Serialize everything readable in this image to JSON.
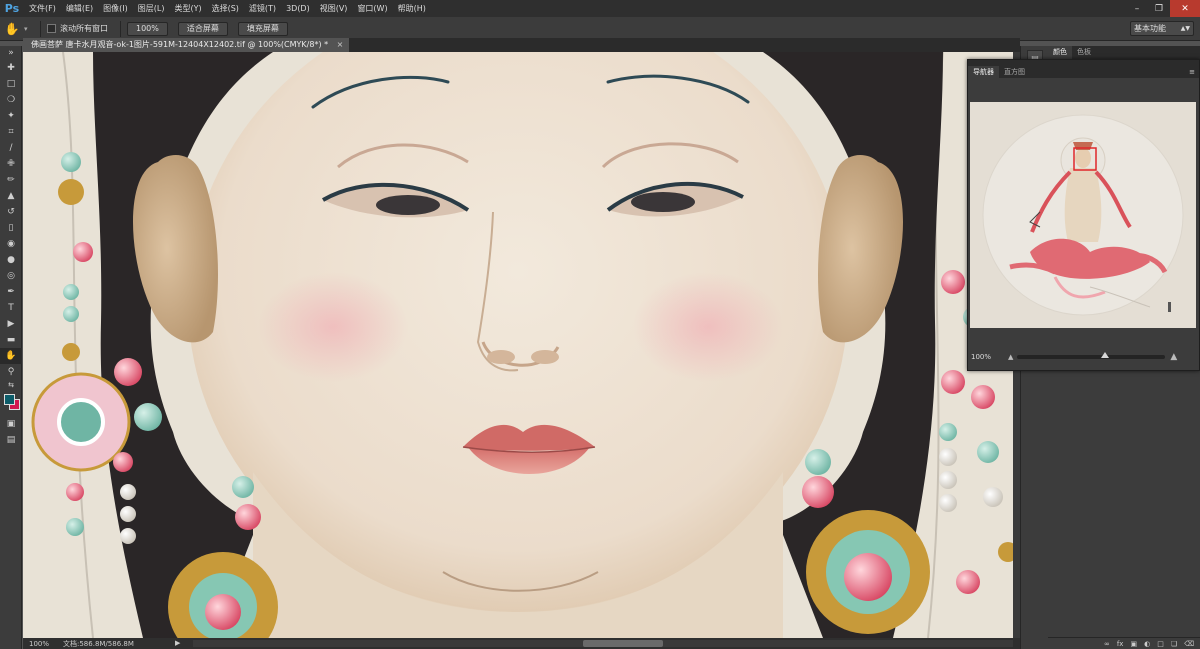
{
  "app": {
    "logo": "Ps",
    "menus": [
      "文件(F)",
      "编辑(E)",
      "图像(I)",
      "图层(L)",
      "类型(Y)",
      "选择(S)",
      "滤镜(T)",
      "3D(D)",
      "视图(V)",
      "窗口(W)",
      "帮助(H)"
    ]
  },
  "options": {
    "scroll_all_label": "滚动所有窗口",
    "btn_100": "100%",
    "btn_fit": "适合屏幕",
    "btn_fill": "填充屏幕",
    "workspace": "基本功能"
  },
  "document": {
    "tab_title": "佛画菩萨 唐卡水月观音-ok-1图片-591M-12404X12402.tif @ 100%(CMYK/8*) *",
    "close_glyph": "×"
  },
  "status": {
    "zoom": "100%",
    "doc_size": "文档:586.8M/586.8M"
  },
  "panels": {
    "color_tab": "颜色",
    "swatches_tab": "色板",
    "navigator_tab": "导航器",
    "histogram_tab": "直方图",
    "navigator_zoom": "100%"
  },
  "colors": {
    "foreground": "#0d5d6a",
    "background": "#d0174f"
  },
  "icons": {
    "hand": "hand-icon",
    "minimize": "minimize-icon",
    "restore": "restore-icon",
    "close": "close-icon"
  }
}
